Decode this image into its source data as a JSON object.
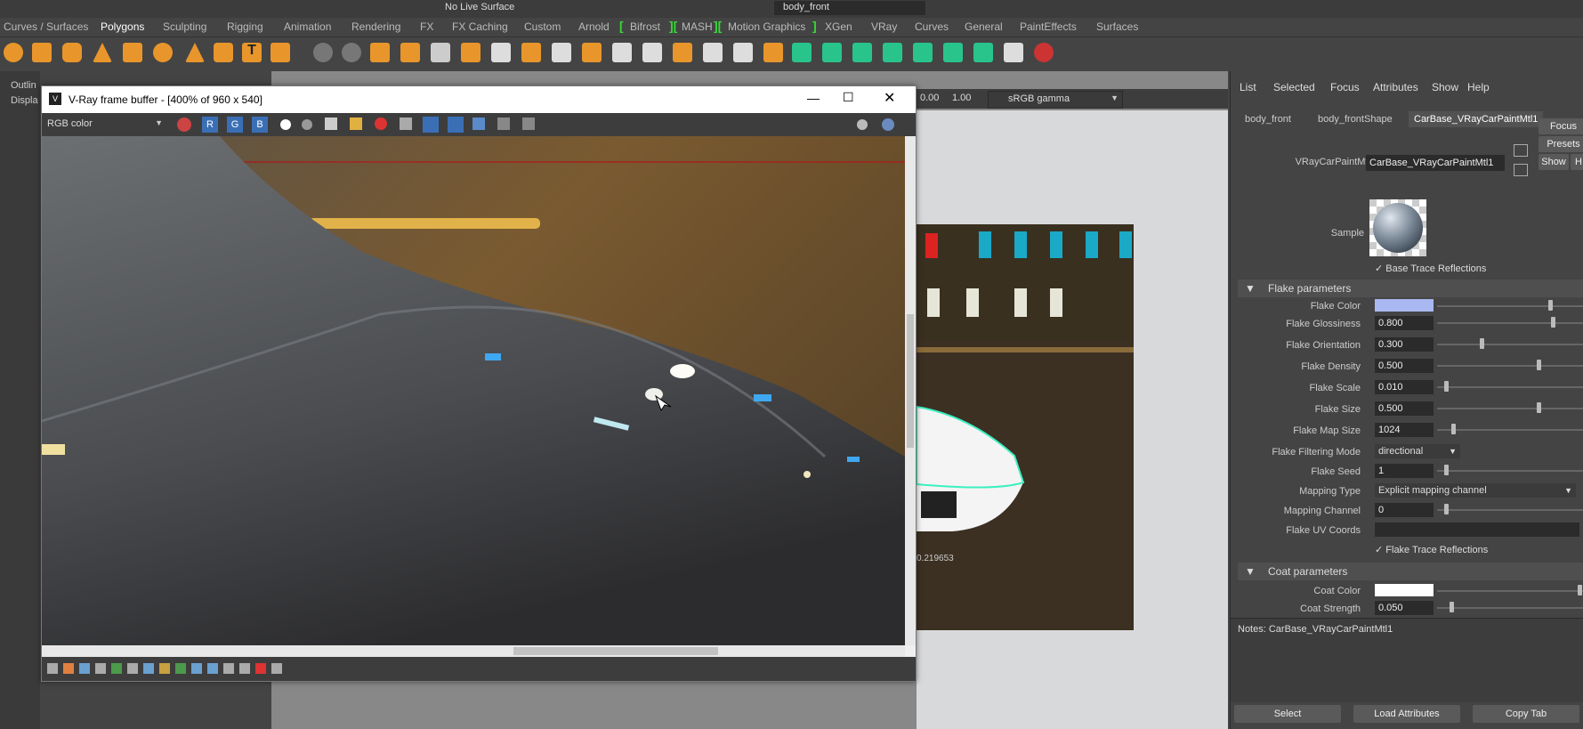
{
  "top_bar": {
    "live_surface": "No Live Surface",
    "object_field": "body_front"
  },
  "shelf_tabs": [
    "Curves / Surfaces",
    "Polygons",
    "Sculpting",
    "Rigging",
    "Animation",
    "Rendering",
    "FX",
    "FX Caching",
    "Custom",
    "Arnold",
    "Bifrost",
    "MASH",
    "Motion Graphics",
    "XGen",
    "VRay",
    "Curves",
    "General",
    "PaintEffects",
    "Surfaces"
  ],
  "active_shelf_tab": "Polygons",
  "left_panel": {
    "outliner": "Outlin",
    "display": "Displa"
  },
  "vfb": {
    "title": "V-Ray frame buffer - [400% of 960 x 540]",
    "channel": "RGB color",
    "rgb_buttons": [
      "R",
      "G",
      "B"
    ]
  },
  "viewport_toolbar": {
    "value1": "0.00",
    "value2": "1.00",
    "colorspace": "sRGB gamma"
  },
  "viewport_overlay": "0.219653",
  "attr_editor": {
    "menu": [
      "List",
      "Selected",
      "Focus",
      "Attributes",
      "Show",
      "Help"
    ],
    "tabs": [
      "body_front",
      "body_frontShape",
      "CarBase_VRayCarPaintMtl1"
    ],
    "active_tab": "CarBase_VRayCarPaintMtl1",
    "buttons": {
      "focus": "Focus",
      "presets": "Presets",
      "show": "Show",
      "hide": "H"
    },
    "node_label": "VRayCarPaintMtl:",
    "node_value": "CarBase_VRayCarPaintMtl1",
    "sample_label": "Sample",
    "base_trace_reflections": "Base Trace Reflections",
    "flake_section": "Flake parameters",
    "flake_color_label": "Flake Color",
    "flake_color": "#a9b8f0",
    "fields": [
      {
        "label": "Flake Glossiness",
        "value": "0.800",
        "slider": 0.8
      },
      {
        "label": "Flake Orientation",
        "value": "0.300",
        "slider": 0.3
      },
      {
        "label": "Flake Density",
        "value": "0.500",
        "slider": 0.7
      },
      {
        "label": "Flake Scale",
        "value": "0.010",
        "slider": 0.05
      },
      {
        "label": "Flake Size",
        "value": "0.500",
        "slider": 0.7
      },
      {
        "label": "Flake Map Size",
        "value": "1024",
        "slider": 0.1
      }
    ],
    "filtering_label": "Flake Filtering Mode",
    "filtering_value": "directional",
    "seed_label": "Flake Seed",
    "seed_value": "1",
    "seed_slider": 0.05,
    "mapping_type_label": "Mapping Type",
    "mapping_type_value": "Explicit mapping channel",
    "mapping_channel_label": "Mapping Channel",
    "mapping_channel_value": "0",
    "mapping_channel_slider": 0.05,
    "uv_coords_label": "Flake UV Coords",
    "flake_trace_reflections": "Flake Trace Reflections",
    "coat_section": "Coat parameters",
    "coat_color_label": "Coat Color",
    "coat_color": "#ffffff",
    "coat_strength_label": "Coat Strength",
    "coat_strength_value": "0.050",
    "coat_strength_slider": 0.05,
    "notes": "Notes:  CarBase_VRayCarPaintMtl1",
    "bottom_buttons": [
      "Select",
      "Load Attributes",
      "Copy Tab"
    ]
  }
}
